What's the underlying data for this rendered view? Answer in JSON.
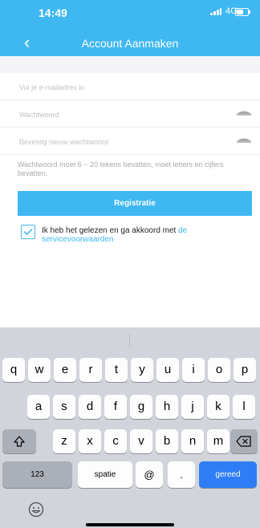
{
  "status_bar": {
    "time": "14:49",
    "network": "4G"
  },
  "nav": {
    "title": "Account Aanmaken"
  },
  "form": {
    "email_placeholder": "Vul je e-mailadres in",
    "password_placeholder": "Wachtwoord",
    "confirm_placeholder": "Bevestig nieuw wachtwoord",
    "hint": "Wachtwoord moet 6 ~ 20 tekens bevatten, moet letters en cijfers bevatten.",
    "register_label": "Registratie",
    "agree_text": "Ik heb het gelezen en ga akkoord met ",
    "agree_link": "de servicevoorwaarden"
  },
  "keyboard": {
    "row1": [
      "q",
      "w",
      "e",
      "r",
      "t",
      "y",
      "u",
      "i",
      "o",
      "p"
    ],
    "row2": [
      "a",
      "s",
      "d",
      "f",
      "g",
      "h",
      "j",
      "k",
      "l"
    ],
    "row3": [
      "z",
      "x",
      "c",
      "v",
      "b",
      "n",
      "m"
    ],
    "numbers_key": "123",
    "space_key": "spatie",
    "at_key": "@",
    "dot_key": ".",
    "done_key": "gereed"
  },
  "colors": {
    "accent": "#3fb8f2",
    "done_key": "#2f7df6"
  }
}
